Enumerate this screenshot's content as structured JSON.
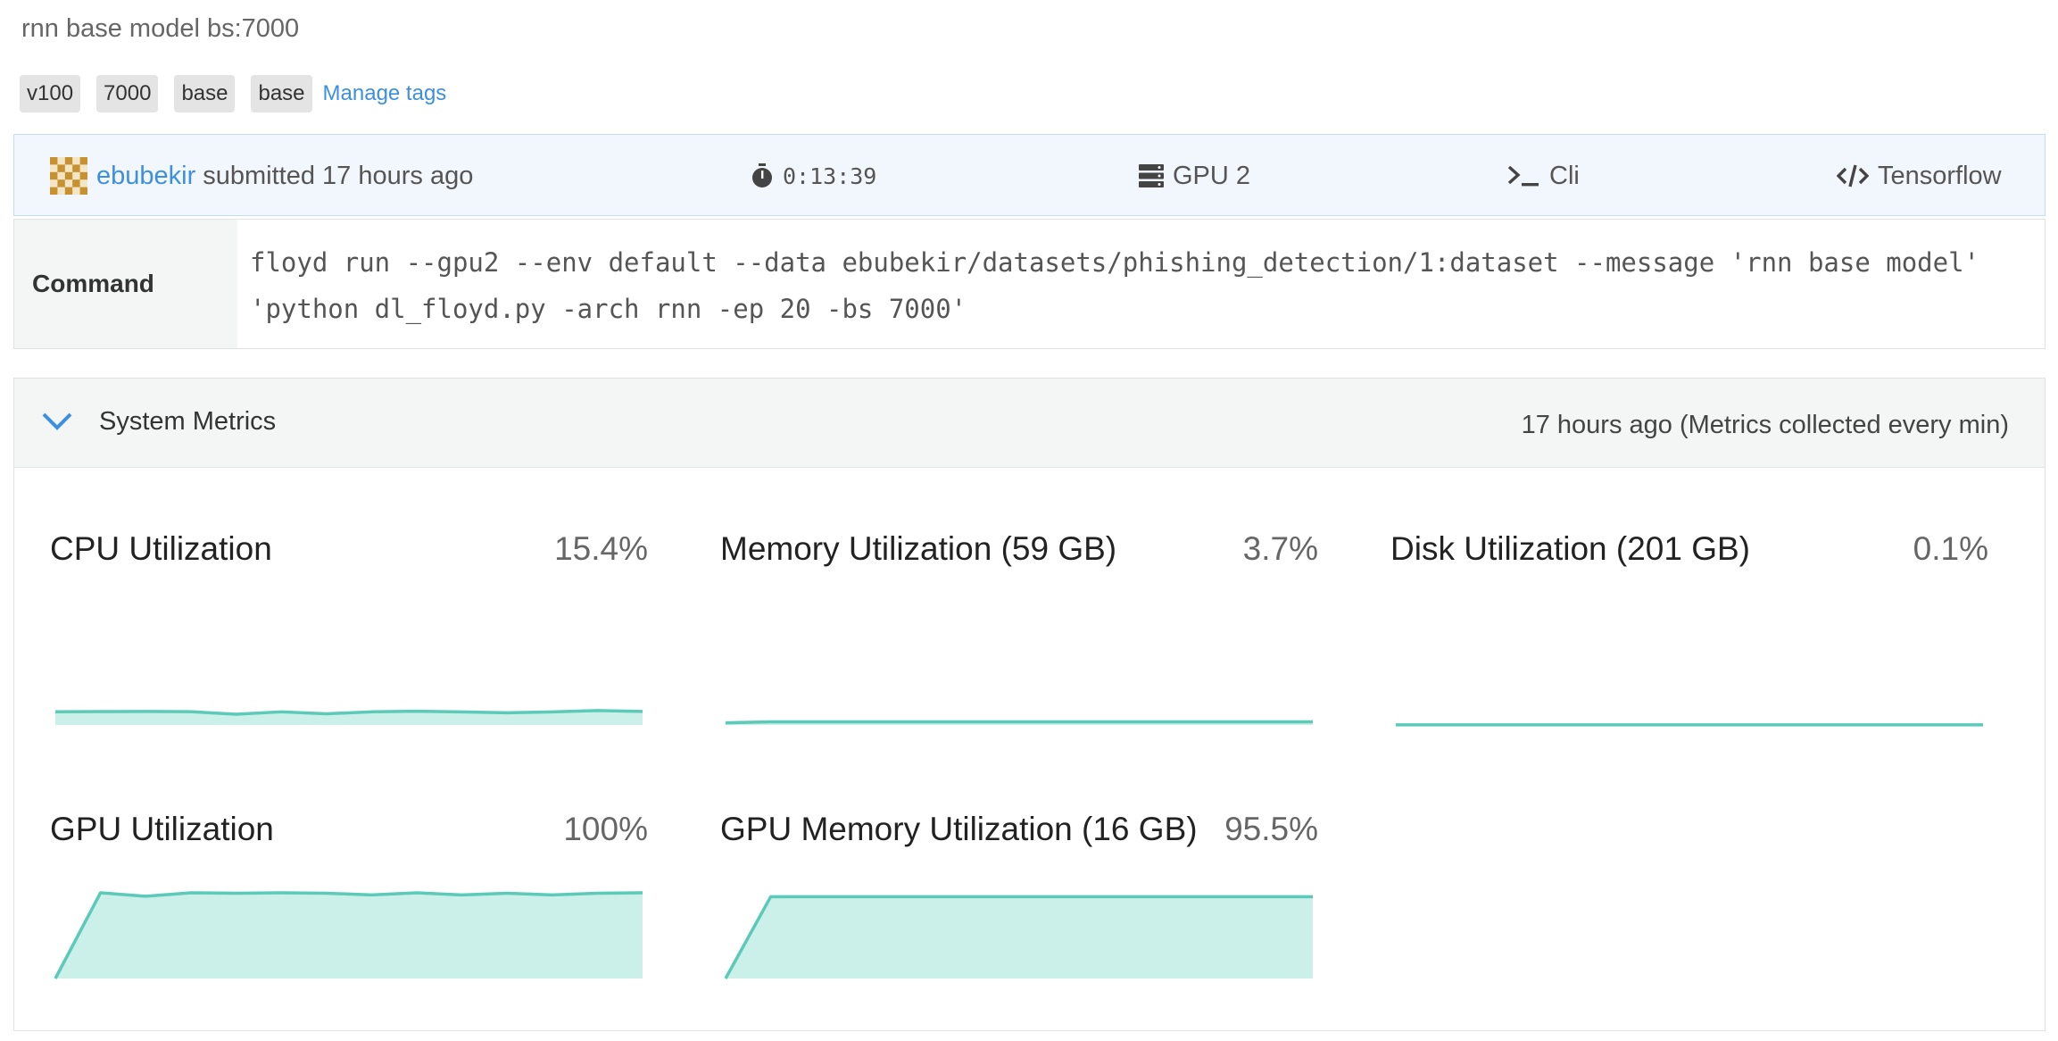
{
  "title": "rnn base model bs:7000",
  "tags": [
    "v100",
    "7000",
    "base",
    "base"
  ],
  "manage_tags": "Manage tags",
  "info": {
    "user": "ebubekir",
    "submitted": "submitted 17 hours ago",
    "duration": "0:13:39",
    "machine": "GPU 2",
    "mode": "Cli",
    "env": "Tensorflow"
  },
  "command": {
    "label": "Command",
    "text": "floyd run --gpu2 --env default --data ebubekir/datasets/phishing_detection/1:dataset --message 'rnn base model' 'python dl_floyd.py -arch rnn -ep 20 -bs 7000'"
  },
  "metrics": {
    "title": "System Metrics",
    "note": "17 hours ago (Metrics collected every min)"
  },
  "colors": {
    "accent": "#3d8fe0",
    "line": "#5ccab8",
    "fill": "#cbefe9"
  },
  "chart_data": [
    {
      "type": "area",
      "title": "CPU Utilization",
      "value": "15.4%",
      "ylim": [
        0,
        100
      ],
      "values": [
        15.4,
        15.6,
        15.8,
        15.5,
        12.5,
        15.3,
        13,
        15.3,
        16,
        15.2,
        14.2,
        15.2,
        16.8,
        15.8
      ]
    },
    {
      "type": "area",
      "title": "Memory Utilization (59 GB)",
      "value": "3.7%",
      "ylim": [
        0,
        100
      ],
      "values": [
        2.5,
        3.7,
        3.7,
        3.7,
        3.7,
        3.7,
        3.7,
        3.7,
        3.7,
        3.7,
        3.7,
        3.7,
        3.7,
        3.7
      ]
    },
    {
      "type": "area",
      "title": "Disk Utilization (201 GB)",
      "value": "0.1%",
      "ylim": [
        0,
        100
      ],
      "values": [
        0.1,
        0.1,
        0.1,
        0.1,
        0.1,
        0.1,
        0.1,
        0.1,
        0.1,
        0.1,
        0.1,
        0.1,
        0.1,
        0.1
      ]
    },
    {
      "type": "area",
      "title": "GPU Utilization",
      "value": "100%",
      "ylim": [
        0,
        100
      ],
      "values": [
        0,
        100,
        96,
        100,
        99.5,
        100,
        99.5,
        97.5,
        100,
        97.5,
        99.5,
        97.5,
        99.5,
        100
      ]
    },
    {
      "type": "area",
      "title": "GPU Memory Utilization (16 GB)",
      "value": "95.5%",
      "ylim": [
        0,
        100
      ],
      "values": [
        0,
        95.5,
        95.5,
        95.5,
        95.5,
        95.5,
        95.5,
        95.5,
        95.5,
        95.5,
        95.5,
        95.5,
        95.5,
        95.5
      ]
    }
  ]
}
